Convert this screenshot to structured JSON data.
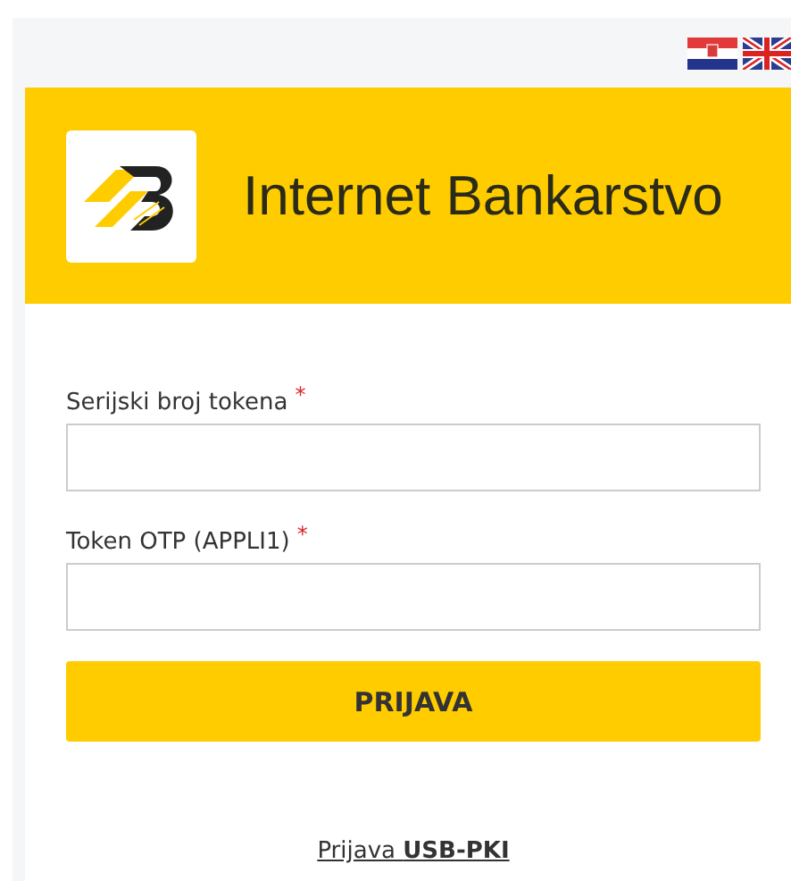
{
  "header": {
    "title": "Internet Bankarstvo"
  },
  "fields": [
    {
      "label": "Serijski broj tokena",
      "required_mark": "*"
    },
    {
      "label": "Token OTP (APPLI1)",
      "required_mark": "*"
    }
  ],
  "login_button": "PRIJAVA",
  "alt_login_link": "Prijava **USB-PKI**"
}
